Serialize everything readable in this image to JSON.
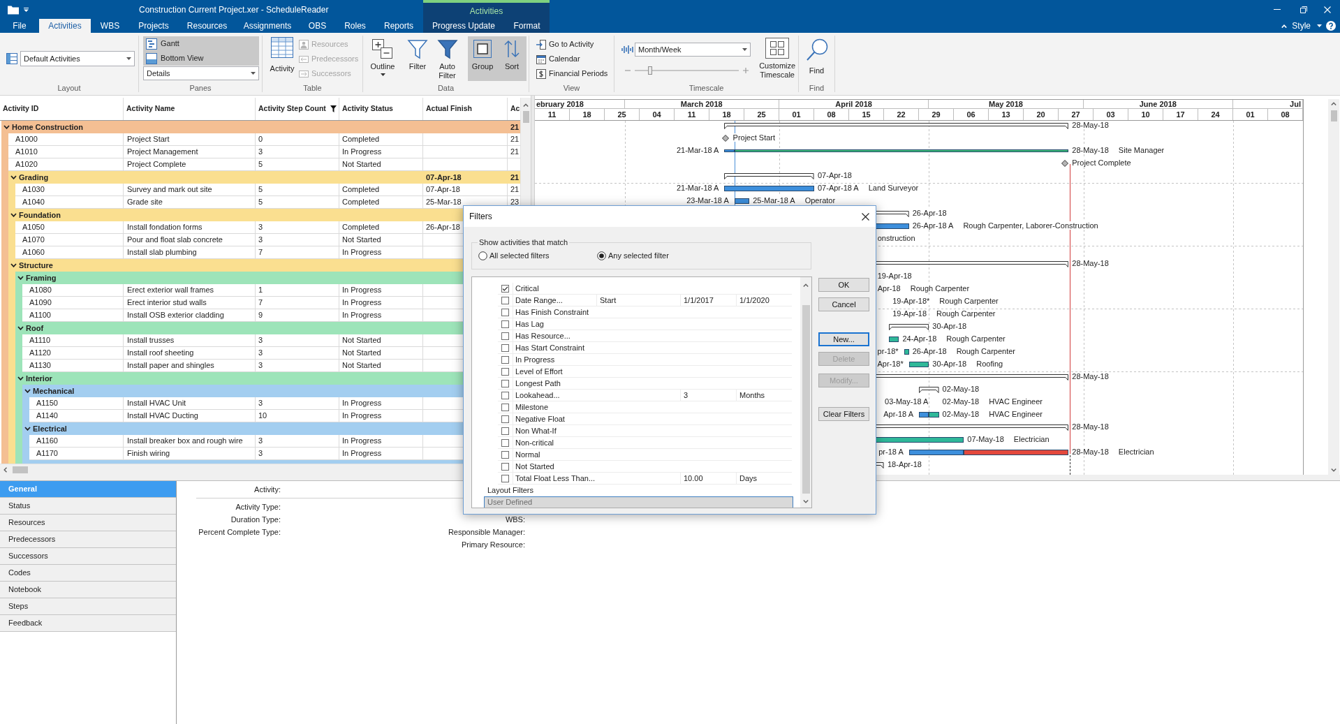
{
  "title_bar": {
    "title": "Construction Current Project.xer - ScheduleReader",
    "context_label": "Activities",
    "style_menu": "Style"
  },
  "ribbon_tabs": [
    {
      "label": "File",
      "selected": false
    },
    {
      "label": "Activities",
      "selected": true
    },
    {
      "label": "WBS",
      "selected": false
    },
    {
      "label": "Projects",
      "selected": false
    },
    {
      "label": "Resources",
      "selected": false
    },
    {
      "label": "Assignments",
      "selected": false
    },
    {
      "label": "OBS",
      "selected": false
    },
    {
      "label": "Roles",
      "selected": false
    },
    {
      "label": "Reports",
      "selected": false
    }
  ],
  "context_tabs": [
    {
      "label": "Progress Update",
      "selected": false
    },
    {
      "label": "Format",
      "selected": false
    }
  ],
  "ribbon_groups": [
    {
      "kind": "layout",
      "label": "Layout",
      "dropdown": "Default Activities"
    },
    {
      "kind": "panes",
      "label": "Panes",
      "toggles": [
        {
          "label": "Gantt",
          "selected": true
        },
        {
          "label": "Bottom View",
          "selected": true
        }
      ],
      "dropdown": "Details"
    },
    {
      "kind": "table",
      "label": "Table",
      "button": "Activity",
      "items": [
        {
          "label": "Resources",
          "disabled": true
        },
        {
          "label": "Predecessors",
          "disabled": true
        },
        {
          "label": "Successors",
          "disabled": true
        }
      ]
    },
    {
      "kind": "data",
      "label": "Data",
      "buttons": [
        {
          "label": "Outline",
          "menu": true,
          "selected": false
        },
        {
          "label": "Filter",
          "menu": false,
          "selected": false
        },
        {
          "label": "Auto Filter",
          "menu": false,
          "selected": false
        },
        {
          "label": "Group",
          "menu": false,
          "selected": true
        },
        {
          "label": "Sort",
          "menu": false,
          "selected": true
        }
      ]
    },
    {
      "kind": "view",
      "label": "View",
      "items": [
        {
          "label": "Go to Activity"
        },
        {
          "label": "Calendar"
        },
        {
          "label": "Financial Periods"
        }
      ]
    },
    {
      "kind": "timescale",
      "label": "Timescale",
      "dropdown": "Month/Week",
      "zoom": {
        "level": 0.15
      },
      "button": "Customize Timescale"
    },
    {
      "kind": "find",
      "label": "Find",
      "button": "Find"
    }
  ],
  "activity_table": {
    "columns": [
      {
        "label": "Activity ID",
        "filtered": false
      },
      {
        "label": "Activity Name",
        "filtered": false
      },
      {
        "label": "Activity Step Count",
        "filtered": true
      },
      {
        "label": "Activity Status",
        "filtered": false
      },
      {
        "label": "Actual Finish",
        "filtered": false
      },
      {
        "label": "Ac",
        "filtered": false
      }
    ],
    "rows": [
      {
        "kind": "group",
        "name": "Home Construction",
        "expanded": true,
        "column_6": "21",
        "gantt": {
          "bars": [
            {
              "kind": "summary"
            }
          ],
          "labels": [
            {
              "kind": "after",
              "text": "28-May-18"
            }
          ]
        },
        "children": [
          {
            "kind": "activity",
            "id": "A1000",
            "name": "Project Start",
            "step_count": "0",
            "status": "Completed",
            "column_6": "21",
            "gantt": {
              "bars": [
                {
                  "kind": "milestone"
                }
              ],
              "labels": [
                {
                  "kind": "after",
                  "text": "Project Start"
                }
              ]
            }
          },
          {
            "kind": "activity",
            "id": "A1010",
            "name": "Project Management",
            "step_count": "3",
            "status": "In Progress",
            "column_6": "21",
            "gantt": {
              "bars": [
                {
                  "kind": "worked"
                },
                {
                  "kind": "effort"
                }
              ],
              "labels": [
                {
                  "kind": "before",
                  "text": "21-Mar-18 A"
                },
                {
                  "kind": "after",
                  "text": "28-May-18",
                  "resource": "Site Manager"
                }
              ]
            }
          },
          {
            "kind": "activity",
            "id": "A1020",
            "name": "Project Complete",
            "step_count": "5",
            "status": "Not Started",
            "gantt": {
              "bars": [
                {
                  "kind": "milestone"
                }
              ],
              "labels": [
                {
                  "kind": "after",
                  "text": "Project Complete"
                }
              ]
            }
          },
          {
            "kind": "group",
            "name": "Grading",
            "expanded": true,
            "actual_finish": "07-Apr-18",
            "column_6": "21",
            "gantt": {
              "bars": [
                {
                  "kind": "summary"
                }
              ],
              "labels": [
                {
                  "kind": "after",
                  "text": "07-Apr-18"
                }
              ]
            },
            "children": [
              {
                "kind": "activity",
                "id": "A1030",
                "name": "Survey and mark out site",
                "step_count": "5",
                "status": "Completed",
                "actual_finish": "07-Apr-18",
                "column_6": "21",
                "gantt": {
                  "bars": [
                    {
                      "kind": "actual"
                    }
                  ],
                  "labels": [
                    {
                      "kind": "before",
                      "text": "21-Mar-18 A"
                    },
                    {
                      "kind": "after",
                      "text": "07-Apr-18 A",
                      "resource": "Land Surveyor"
                    }
                  ]
                }
              },
              {
                "kind": "activity",
                "id": "A1040",
                "name": "Grade site",
                "step_count": "5",
                "status": "Completed",
                "actual_finish": "25-Mar-18",
                "column_6": "23",
                "gantt": {
                  "bars": [
                    {
                      "kind": "actual"
                    }
                  ],
                  "labels": [
                    {
                      "kind": "before",
                      "text": "23-Mar-18 A"
                    },
                    {
                      "kind": "after",
                      "text": "25-Mar-18 A",
                      "resource": "Operator"
                    }
                  ]
                }
              }
            ]
          },
          {
            "kind": "group",
            "name": "Foundation",
            "expanded": true,
            "gantt": {
              "bars": [
                {
                  "kind": "summary"
                }
              ],
              "labels": [
                {
                  "kind": "after",
                  "text": "26-Apr-18"
                }
              ]
            },
            "children": [
              {
                "kind": "activity",
                "id": "A1050",
                "name": "Install fondation forms",
                "step_count": "3",
                "status": "Completed",
                "actual_finish": "26-Apr-18",
                "gantt": {
                  "bars": [
                    {
                      "kind": "actual"
                    }
                  ],
                  "labels": [
                    {
                      "kind": "after",
                      "text": "26-Apr-18 A",
                      "resource": "Rough Carpenter, Laborer-Construction"
                    }
                  ]
                }
              },
              {
                "kind": "activity",
                "id": "A1070",
                "name": "Pour and float slab concrete",
                "step_count": "3",
                "status": "Not Started",
                "gantt": {
                  "labels": [
                    {
                      "kind": "after",
                      "text": "onstruction"
                    }
                  ]
                }
              },
              {
                "kind": "activity",
                "id": "A1060",
                "name": "Install slab plumbing",
                "step_count": "7",
                "status": "In Progress"
              }
            ]
          },
          {
            "kind": "group",
            "name": "Structure",
            "expanded": true,
            "gantt": {
              "bars": [
                {
                  "kind": "summary"
                }
              ],
              "labels": [
                {
                  "kind": "after",
                  "text": "28-May-18"
                }
              ]
            },
            "children": [
              {
                "kind": "group",
                "name": "Framing",
                "expanded": true,
                "gantt": {
                  "labels": [
                    {
                      "kind": "after",
                      "text": "19-Apr-18"
                    }
                  ]
                },
                "children": [
                  {
                    "kind": "activity",
                    "id": "A1080",
                    "name": "Erect exterior wall frames",
                    "step_count": "1",
                    "status": "In Progress",
                    "gantt": {
                      "labels": [
                        {
                          "kind": "after",
                          "text": "Apr-18",
                          "resource": "Rough Carpenter"
                        }
                      ]
                    }
                  },
                  {
                    "kind": "activity",
                    "id": "A1090",
                    "name": "Erect interior stud walls",
                    "step_count": "7",
                    "status": "In Progress",
                    "gantt": {
                      "labels": [
                        {
                          "kind": "after",
                          "text": "19-Apr-18*",
                          "resource": "Rough Carpenter"
                        }
                      ]
                    }
                  },
                  {
                    "kind": "activity",
                    "id": "A1100",
                    "name": "Install OSB exterior cladding",
                    "step_count": "9",
                    "status": "In Progress",
                    "gantt": {
                      "labels": [
                        {
                          "kind": "after",
                          "text": "19-Apr-18",
                          "resource": "Rough Carpenter"
                        }
                      ]
                    }
                  }
                ]
              },
              {
                "kind": "group",
                "name": "Roof",
                "expanded": true,
                "gantt": {
                  "bars": [
                    {
                      "kind": "summary"
                    }
                  ],
                  "labels": [
                    {
                      "kind": "after",
                      "text": "30-Apr-18"
                    }
                  ]
                },
                "children": [
                  {
                    "kind": "activity",
                    "id": "A1110",
                    "name": "Install trusses",
                    "step_count": "3",
                    "status": "Not Started",
                    "gantt": {
                      "bars": [
                        {
                          "kind": "remaining"
                        }
                      ],
                      "labels": [
                        {
                          "kind": "after",
                          "text": "24-Apr-18",
                          "resource": "Rough Carpenter"
                        }
                      ]
                    }
                  },
                  {
                    "kind": "activity",
                    "id": "A1120",
                    "name": "Install roof sheeting",
                    "step_count": "3",
                    "status": "Not Started",
                    "gantt": {
                      "bars": [
                        {
                          "kind": "remaining"
                        }
                      ],
                      "labels": [
                        {
                          "kind": "before",
                          "text": "pr-18*"
                        },
                        {
                          "kind": "after",
                          "text": "26-Apr-18",
                          "resource": "Rough Carpenter"
                        }
                      ]
                    }
                  },
                  {
                    "kind": "activity",
                    "id": "A1130",
                    "name": "Install paper and shingles",
                    "step_count": "3",
                    "status": "Not Started",
                    "gantt": {
                      "bars": [
                        {
                          "kind": "remaining"
                        }
                      ],
                      "labels": [
                        {
                          "kind": "before",
                          "text": "Apr-18*"
                        },
                        {
                          "kind": "after",
                          "text": "30-Apr-18",
                          "resource": "Roofing"
                        }
                      ]
                    }
                  }
                ]
              },
              {
                "kind": "group",
                "name": "Interior",
                "expanded": true,
                "gantt": {
                  "bars": [
                    {
                      "kind": "summary"
                    }
                  ],
                  "labels": [
                    {
                      "kind": "after",
                      "text": "28-May-18"
                    }
                  ]
                },
                "children": [
                  {
                    "kind": "group",
                    "name": "Mechanical",
                    "expanded": true,
                    "gantt": {
                      "bars": [
                        {
                          "kind": "summary"
                        }
                      ],
                      "labels": [
                        {
                          "kind": "after",
                          "text": "02-May-18"
                        }
                      ]
                    },
                    "children": [
                      {
                        "kind": "activity",
                        "id": "A1150",
                        "name": "Install HVAC Unit",
                        "step_count": "3",
                        "status": "In Progress",
                        "gantt": {
                          "labels": [
                            {
                              "kind": "before",
                              "text": "03-May-18 A"
                            },
                            {
                              "kind": "after",
                              "text": "02-May-18",
                              "resource": "HVAC Engineer"
                            }
                          ]
                        }
                      },
                      {
                        "kind": "activity",
                        "id": "A1140",
                        "name": "Install HVAC Ducting",
                        "step_count": "10",
                        "status": "In Progress",
                        "gantt": {
                          "bars": [
                            {
                              "kind": "actual"
                            },
                            {
                              "kind": "remaining"
                            }
                          ],
                          "labels": [
                            {
                              "kind": "before",
                              "text": "Apr-18 A"
                            },
                            {
                              "kind": "after",
                              "text": "02-May-18",
                              "resource": "HVAC Engineer"
                            }
                          ]
                        }
                      }
                    ]
                  },
                  {
                    "kind": "group",
                    "name": "Electrical",
                    "expanded": true,
                    "gantt": {
                      "bars": [
                        {
                          "kind": "summary"
                        }
                      ],
                      "labels": [
                        {
                          "kind": "after",
                          "text": "28-May-18"
                        }
                      ]
                    },
                    "children": [
                      {
                        "kind": "activity",
                        "id": "A1160",
                        "name": "Install breaker box and rough wire",
                        "step_count": "3",
                        "status": "In Progress",
                        "gantt": {
                          "bars": [
                            {
                              "kind": "remaining"
                            }
                          ],
                          "labels": [
                            {
                              "kind": "after",
                              "text": "07-May-18",
                              "resource": "Electrician"
                            }
                          ]
                        }
                      },
                      {
                        "kind": "activity",
                        "id": "A1170",
                        "name": "Finish wiring",
                        "step_count": "3",
                        "status": "In Progress",
                        "gantt": {
                          "bars": [
                            {
                              "kind": "actual"
                            },
                            {
                              "kind": "critical"
                            }
                          ],
                          "labels": [
                            {
                              "kind": "before",
                              "text": "pr-18 A"
                            },
                            {
                              "kind": "after",
                              "text": "28-May-18",
                              "resource": "Electrician"
                            }
                          ]
                        }
                      }
                    ]
                  },
                  {
                    "kind": "group",
                    "gantt": {
                      "bars": [
                        {
                          "kind": "summary"
                        }
                      ],
                      "labels": [
                        {
                          "kind": "after",
                          "text": "18-Apr-18"
                        }
                      ]
                    }
                  }
                ]
              }
            ]
          }
        ]
      }
    ]
  },
  "gantt": {
    "months": [
      "ebruary 2018",
      "March 2018",
      "April 2018",
      "May 2018",
      "June 2018",
      "Jul"
    ],
    "weeks": [
      "11",
      "18",
      "25",
      "04",
      "11",
      "18",
      "25",
      "01",
      "08",
      "15",
      "22",
      "29",
      "06",
      "13",
      "20",
      "27",
      "03",
      "10",
      "17",
      "24",
      "01",
      "08"
    ]
  },
  "filters_dialog": {
    "title": "Filters",
    "match": {
      "label": "Show activities that match",
      "options": [
        {
          "label": "All selected filters",
          "selected": false
        },
        {
          "label": "Any selected filter",
          "selected": true
        }
      ]
    },
    "list": [
      {
        "kind": "filter",
        "label": "Critical",
        "checked": true
      },
      {
        "kind": "filter",
        "label": "Date Range...",
        "checked": false,
        "column_3": "Start",
        "column_4": "1/1/2017",
        "column_5": "1/1/2020"
      },
      {
        "kind": "filter",
        "label": "Has Finish Constraint",
        "checked": false
      },
      {
        "kind": "filter",
        "label": "Has Lag",
        "checked": false
      },
      {
        "kind": "filter",
        "label": "Has Resource...",
        "checked": false
      },
      {
        "kind": "filter",
        "label": "Has Start Constraint",
        "checked": false
      },
      {
        "kind": "filter",
        "label": "In Progress",
        "checked": false
      },
      {
        "kind": "filter",
        "label": "Level of Effort",
        "checked": false
      },
      {
        "kind": "filter",
        "label": "Longest Path",
        "checked": false
      },
      {
        "kind": "filter",
        "label": "Lookahead...",
        "checked": false,
        "column_4": "3",
        "column_5": "Months"
      },
      {
        "kind": "filter",
        "label": "Milestone",
        "checked": false
      },
      {
        "kind": "filter",
        "label": "Negative Float",
        "checked": false
      },
      {
        "kind": "filter",
        "label": "Non What-If",
        "checked": false
      },
      {
        "kind": "filter",
        "label": "Non-critical",
        "checked": false
      },
      {
        "kind": "filter",
        "label": "Normal",
        "checked": false
      },
      {
        "kind": "filter",
        "label": "Not Started",
        "checked": false
      },
      {
        "kind": "filter",
        "label": "Total Float Less Than...",
        "checked": false,
        "column_4": "10.00",
        "column_5": "Days"
      },
      {
        "kind": "category",
        "label": "Layout Filters",
        "selected": false
      },
      {
        "kind": "category",
        "label": "User Defined",
        "selected": true
      }
    ],
    "buttons": [
      {
        "label": "OK",
        "disabled": false,
        "focused": false
      },
      {
        "label": "Cancel",
        "disabled": false,
        "focused": false
      },
      {
        "label": "New...",
        "disabled": false,
        "focused": true
      },
      {
        "label": "Delete",
        "disabled": true,
        "focused": false
      },
      {
        "label": "Modify...",
        "disabled": true,
        "focused": false
      },
      {
        "label": "Clear Filters",
        "disabled": false,
        "focused": false
      }
    ]
  },
  "details": {
    "tabs": [
      {
        "label": "General",
        "selected": true
      },
      {
        "label": "Status",
        "selected": false
      },
      {
        "label": "Resources",
        "selected": false
      },
      {
        "label": "Predecessors",
        "selected": false
      },
      {
        "label": "Successors",
        "selected": false
      },
      {
        "label": "Codes",
        "selected": false
      },
      {
        "label": "Notebook",
        "selected": false
      },
      {
        "label": "Steps",
        "selected": false
      },
      {
        "label": "Feedback",
        "selected": false
      }
    ],
    "header_field": "Activity:",
    "left_fields": [
      "Activity Type:",
      "Duration Type:",
      "Percent Complete Type:"
    ],
    "right_fields": [
      "WBS:",
      "Responsible Manager:",
      "Primary Resource:"
    ]
  }
}
